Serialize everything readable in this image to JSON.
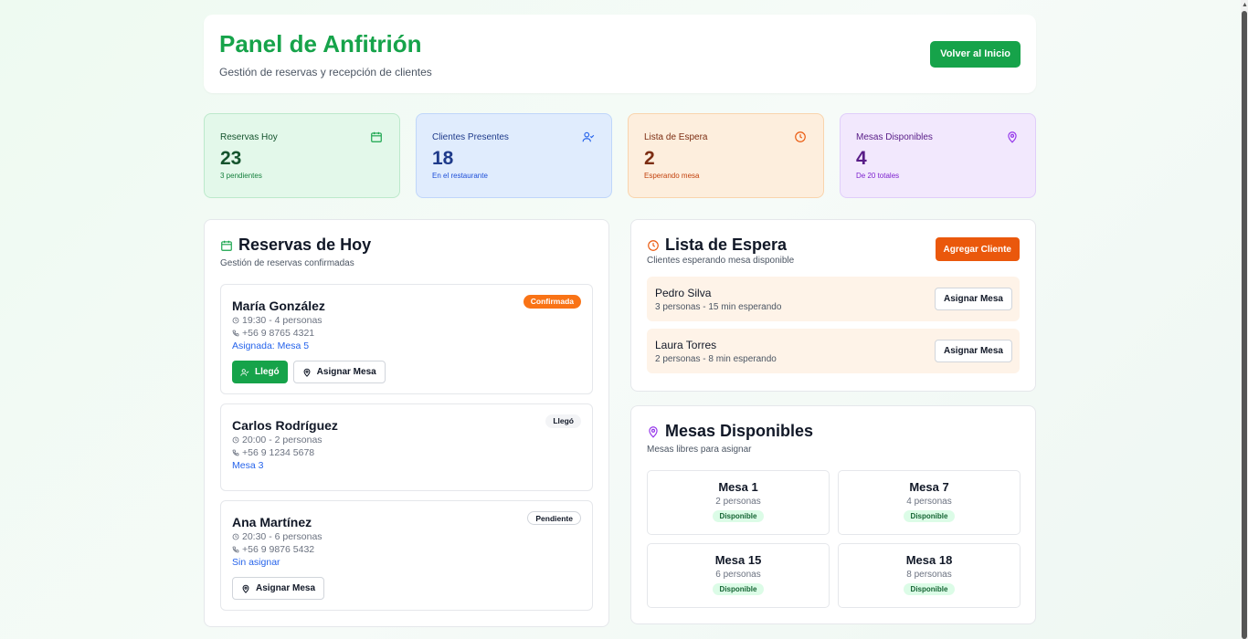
{
  "header": {
    "title": "Panel de Anfitrión",
    "subtitle": "Gestión de reservas y recepción de clientes",
    "back_button": "Volver al Inicio"
  },
  "stats": [
    {
      "label": "Reservas Hoy",
      "value": "23",
      "note": "3 pendientes",
      "icon": "calendar-icon",
      "color": "#16a34a"
    },
    {
      "label": "Clientes Presentes",
      "value": "18",
      "note": "En el restaurante",
      "icon": "user-check-icon",
      "color": "#2563eb"
    },
    {
      "label": "Lista de Espera",
      "value": "2",
      "note": "Esperando mesa",
      "icon": "clock-icon",
      "color": "#ea580c"
    },
    {
      "label": "Mesas Disponibles",
      "value": "4",
      "note": "De 20 totales",
      "icon": "map-pin-icon",
      "color": "#9333ea"
    }
  ],
  "reservations": {
    "title": "Reservas de Hoy",
    "subtitle": "Gestión de reservas confirmadas",
    "items": [
      {
        "name": "María González",
        "time": "19:30 - 4 personas",
        "phone": "+56 9 8765 4321",
        "table": "Asignada: Mesa 5",
        "status": "Confirmada",
        "arrived_button": "Llegó",
        "assign_button": "Asignar Mesa"
      },
      {
        "name": "Carlos Rodríguez",
        "time": "20:00 - 2 personas",
        "phone": "+56 9 1234 5678",
        "table": "Mesa 3",
        "status": "Llegó"
      },
      {
        "name": "Ana Martínez",
        "time": "20:30 - 6 personas",
        "phone": "+56 9 9876 5432",
        "table": "Sin asignar",
        "status": "Pendiente",
        "assign_button": "Asignar Mesa"
      }
    ]
  },
  "waitlist": {
    "title": "Lista de Espera",
    "subtitle": "Clientes esperando mesa disponible",
    "add_button": "Agregar Cliente",
    "items": [
      {
        "name": "Pedro Silva",
        "info": "3 personas - 15 min esperando",
        "button": "Asignar Mesa"
      },
      {
        "name": "Laura Torres",
        "info": "2 personas - 8 min esperando",
        "button": "Asignar Mesa"
      }
    ]
  },
  "tables": {
    "title": "Mesas Disponibles",
    "subtitle": "Mesas libres para asignar",
    "items": [
      {
        "name": "Mesa 1",
        "capacity": "2 personas",
        "status": "Disponible"
      },
      {
        "name": "Mesa 7",
        "capacity": "4 personas",
        "status": "Disponible"
      },
      {
        "name": "Mesa 15",
        "capacity": "6 personas",
        "status": "Disponible"
      },
      {
        "name": "Mesa 18",
        "capacity": "8 personas",
        "status": "Disponible"
      }
    ]
  }
}
